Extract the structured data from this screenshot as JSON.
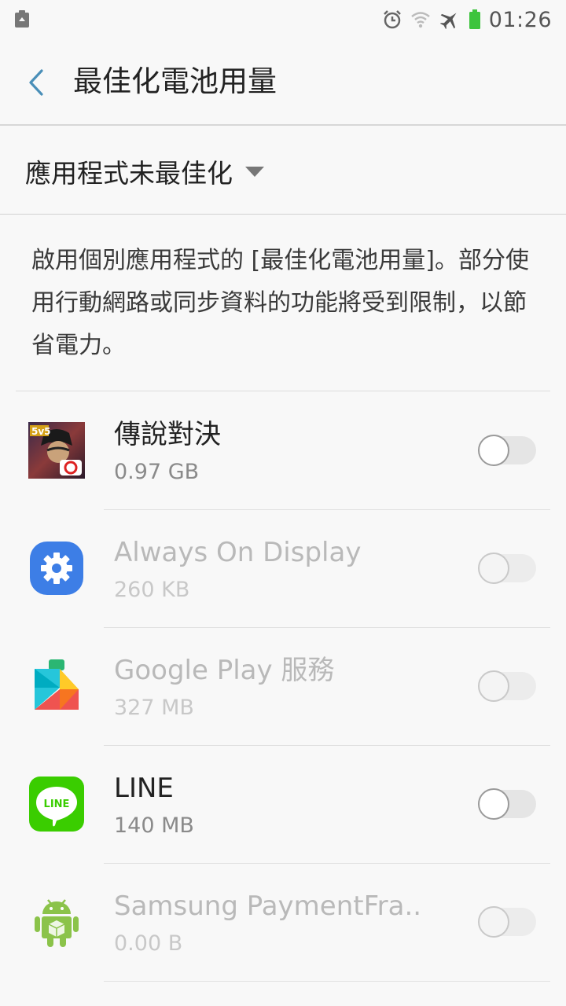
{
  "status_bar": {
    "time": "01:26",
    "icons": [
      "recycle-icon",
      "alarm-icon",
      "wifi-icon",
      "airplane-icon",
      "battery-icon"
    ],
    "battery_color": "#3ec43e"
  },
  "header": {
    "title": "最佳化電池用量",
    "accent": "#4a8fb8"
  },
  "filter": {
    "selected": "應用程式未最佳化"
  },
  "description": "啟用個別應用程式的 [最佳化電池用量]。部分使用行動網路或同步資料的功能將受到限制，以節省電力。",
  "apps": [
    {
      "name": "傳說對決",
      "size": "0.97 GB",
      "enabled": true,
      "optimized": false,
      "icon": "game-icon"
    },
    {
      "name": "Always On Display",
      "size": "260 KB",
      "enabled": false,
      "optimized": false,
      "icon": "settings-gear-icon"
    },
    {
      "name": "Google Play 服務",
      "size": "327 MB",
      "enabled": false,
      "optimized": false,
      "icon": "google-play-services-icon"
    },
    {
      "name": "LINE",
      "size": "140 MB",
      "enabled": true,
      "optimized": false,
      "icon": "line-icon"
    },
    {
      "name": "Samsung PaymentFra..",
      "size": "0.00 B",
      "enabled": false,
      "optimized": false,
      "icon": "android-icon"
    }
  ]
}
